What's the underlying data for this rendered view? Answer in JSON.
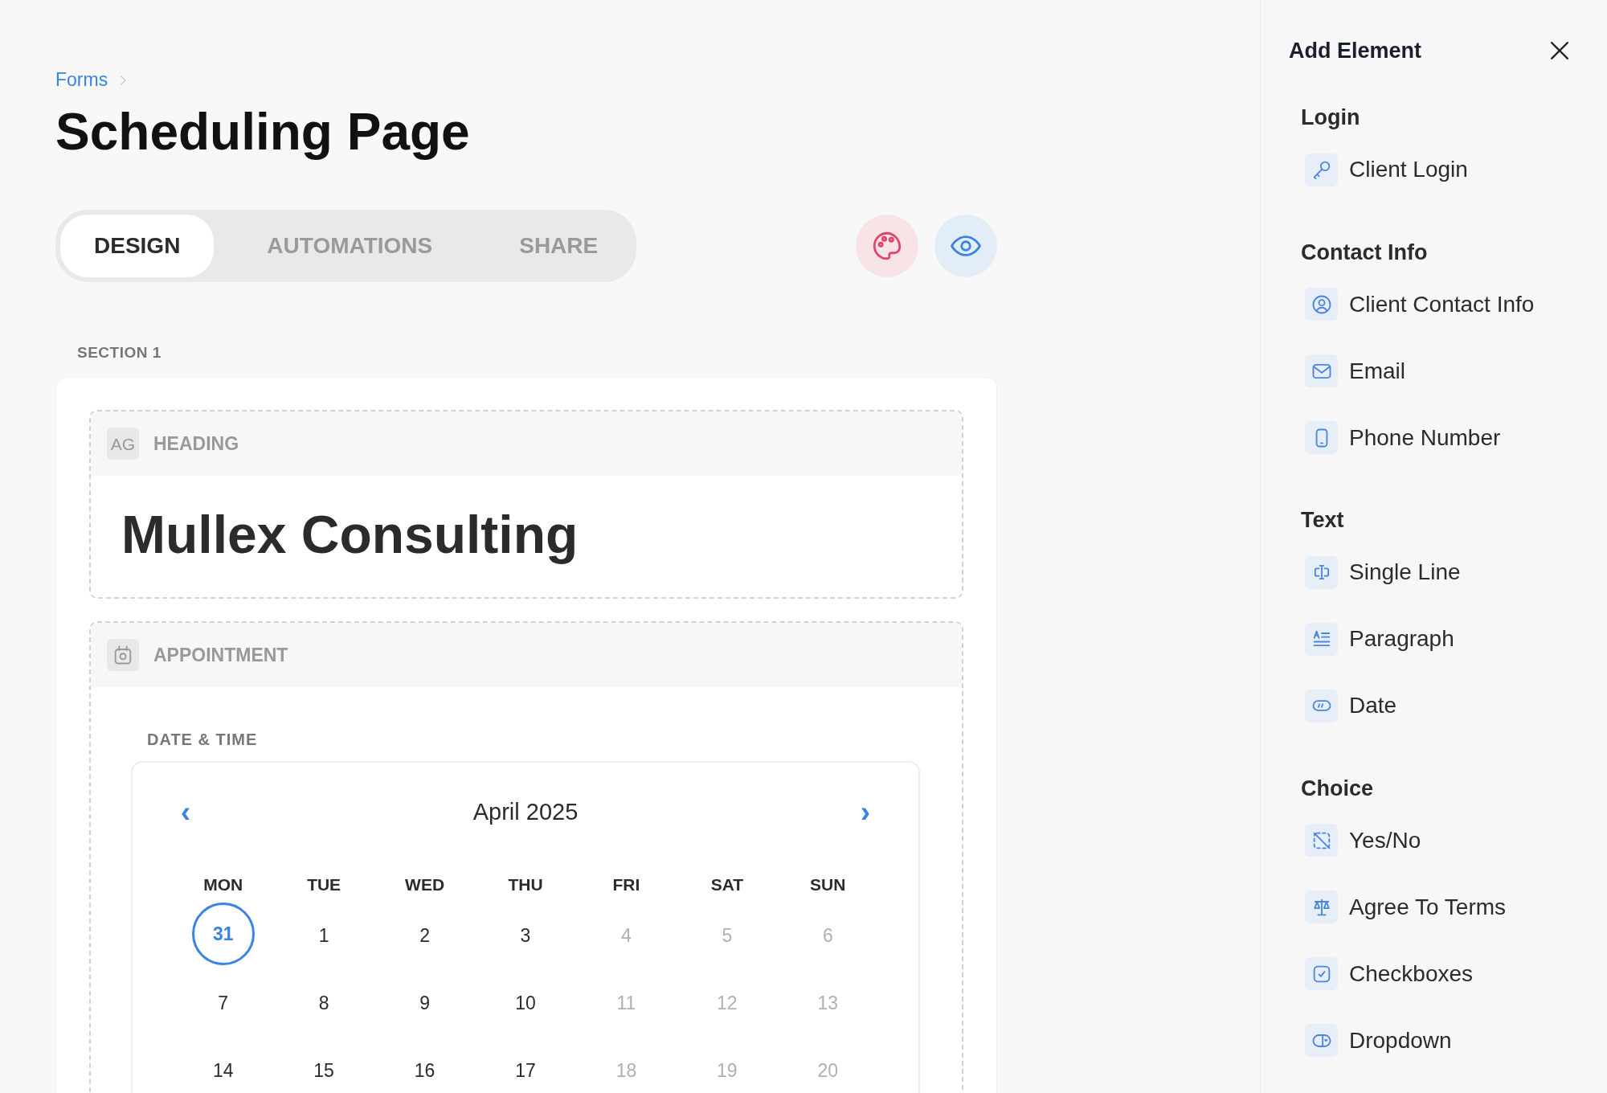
{
  "breadcrumb": {
    "link": "Forms"
  },
  "title": "Scheduling Page",
  "tabs": [
    {
      "label": "DESIGN",
      "selected": true
    },
    {
      "label": "AUTOMATIONS",
      "selected": false
    },
    {
      "label": "SHARE",
      "selected": false
    }
  ],
  "section": {
    "label": "SECTION 1",
    "blocks": [
      {
        "kind": "heading",
        "icon_text": "AG",
        "label": "HEADING",
        "text": "Mullex Consulting"
      },
      {
        "kind": "appointment",
        "label": "APPOINTMENT",
        "field_label": "DATE & TIME",
        "calendar": {
          "prev": "‹",
          "month": "April 2025",
          "next": "›",
          "weekdays": [
            "MON",
            "TUE",
            "WED",
            "THU",
            "FRI",
            "SAT",
            "SUN"
          ],
          "weeks": [
            [
              {
                "day": "31",
                "selected": true,
                "disabled": false
              },
              {
                "day": "1",
                "selected": false,
                "disabled": false
              },
              {
                "day": "2",
                "selected": false,
                "disabled": false
              },
              {
                "day": "3",
                "selected": false,
                "disabled": false
              },
              {
                "day": "4",
                "selected": false,
                "disabled": true
              },
              {
                "day": "5",
                "selected": false,
                "disabled": true
              },
              {
                "day": "6",
                "selected": false,
                "disabled": true
              }
            ],
            [
              {
                "day": "7",
                "selected": false,
                "disabled": false
              },
              {
                "day": "8",
                "selected": false,
                "disabled": false
              },
              {
                "day": "9",
                "selected": false,
                "disabled": false
              },
              {
                "day": "10",
                "selected": false,
                "disabled": false
              },
              {
                "day": "11",
                "selected": false,
                "disabled": true
              },
              {
                "day": "12",
                "selected": false,
                "disabled": true
              },
              {
                "day": "13",
                "selected": false,
                "disabled": true
              }
            ],
            [
              {
                "day": "14",
                "selected": false,
                "disabled": false
              },
              {
                "day": "15",
                "selected": false,
                "disabled": false
              },
              {
                "day": "16",
                "selected": false,
                "disabled": false
              },
              {
                "day": "17",
                "selected": false,
                "disabled": false
              },
              {
                "day": "18",
                "selected": false,
                "disabled": true
              },
              {
                "day": "19",
                "selected": false,
                "disabled": true
              },
              {
                "day": "20",
                "selected": false,
                "disabled": true
              }
            ]
          ]
        }
      }
    ]
  },
  "panel": {
    "title": "Add Element",
    "groups": [
      {
        "label": "Login",
        "items": [
          "Client Login"
        ]
      },
      {
        "label": "Contact Info",
        "items": [
          "Client Contact Info",
          "Email",
          "Phone Number"
        ]
      },
      {
        "label": "Text",
        "items": [
          "Single Line",
          "Paragraph",
          "Date"
        ]
      },
      {
        "label": "Choice",
        "items": [
          "Yes/No",
          "Agree To Terms",
          "Checkboxes",
          "Dropdown"
        ]
      }
    ]
  }
}
